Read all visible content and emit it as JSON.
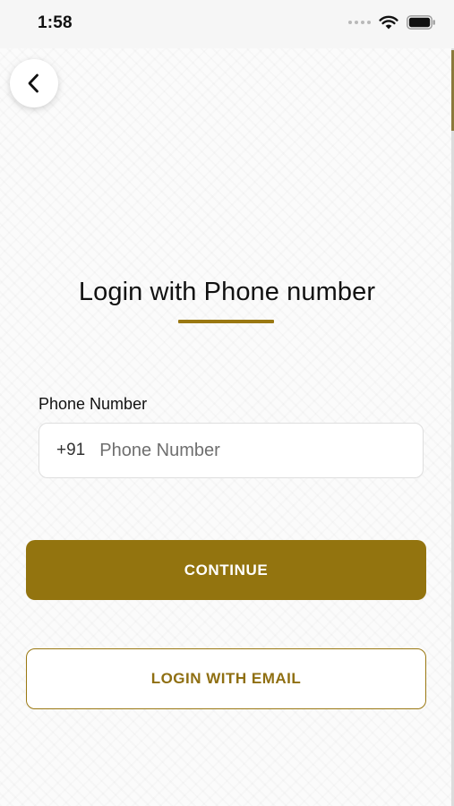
{
  "status_bar": {
    "time": "1:58",
    "icons": [
      "signal-dots-icon",
      "wifi-icon",
      "battery-icon"
    ]
  },
  "header": {
    "back_icon": "chevron-left-icon"
  },
  "title": "Login with Phone number",
  "phone": {
    "label": "Phone Number",
    "country_code": "+91",
    "placeholder": "Phone Number",
    "value": ""
  },
  "buttons": {
    "continue_label": "CONTINUE",
    "email_label": "LOGIN WITH EMAIL"
  },
  "colors": {
    "accent": "#93740f",
    "accent_outline": "#9a7812",
    "text": "#111111"
  }
}
